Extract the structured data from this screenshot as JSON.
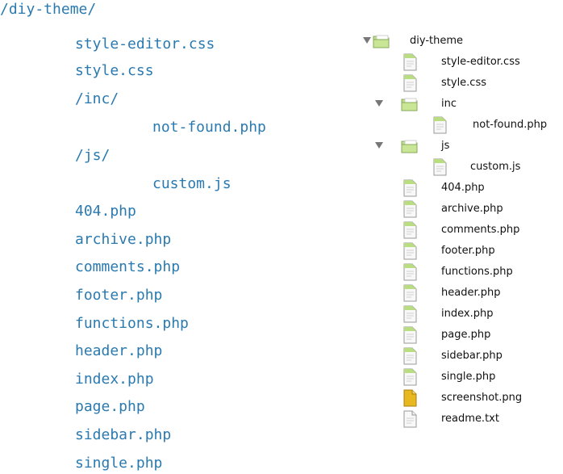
{
  "code_listing": {
    "lines": [
      "/diy-theme/",
      "style-editor.css",
      "style.css",
      "/inc/",
      "not-found.php",
      "/js/",
      "custom.js",
      "404.php",
      "archive.php",
      "comments.php",
      "footer.php",
      "functions.php",
      "header.php",
      "index.php",
      "page.php",
      "sidebar.php",
      "single.php"
    ]
  },
  "finder_tree": {
    "items": [
      {
        "label": "diy-theme",
        "icon": "folder-icon",
        "expanded": true
      },
      {
        "label": "style-editor.css",
        "icon": "document-icon"
      },
      {
        "label": "style.css",
        "icon": "document-icon"
      },
      {
        "label": "inc",
        "icon": "folder-icon",
        "expanded": true
      },
      {
        "label": "not-found.php",
        "icon": "document-icon"
      },
      {
        "label": "js",
        "icon": "folder-icon",
        "expanded": true
      },
      {
        "label": "custom.js",
        "icon": "document-icon"
      },
      {
        "label": "404.php",
        "icon": "document-icon"
      },
      {
        "label": "archive.php",
        "icon": "document-icon"
      },
      {
        "label": "comments.php",
        "icon": "document-icon"
      },
      {
        "label": "footer.php",
        "icon": "document-icon"
      },
      {
        "label": "functions.php",
        "icon": "document-icon"
      },
      {
        "label": "header.php",
        "icon": "document-icon"
      },
      {
        "label": "index.php",
        "icon": "document-icon"
      },
      {
        "label": "page.php",
        "icon": "document-icon"
      },
      {
        "label": "sidebar.php",
        "icon": "document-icon"
      },
      {
        "label": "single.php",
        "icon": "document-icon"
      },
      {
        "label": "screenshot.png",
        "icon": "image-file-icon"
      },
      {
        "label": "readme.txt",
        "icon": "document-icon"
      }
    ]
  },
  "colors": {
    "code_text": "#2a7ab0",
    "folder": "#bfe08a",
    "image_file": "#e8b820"
  }
}
